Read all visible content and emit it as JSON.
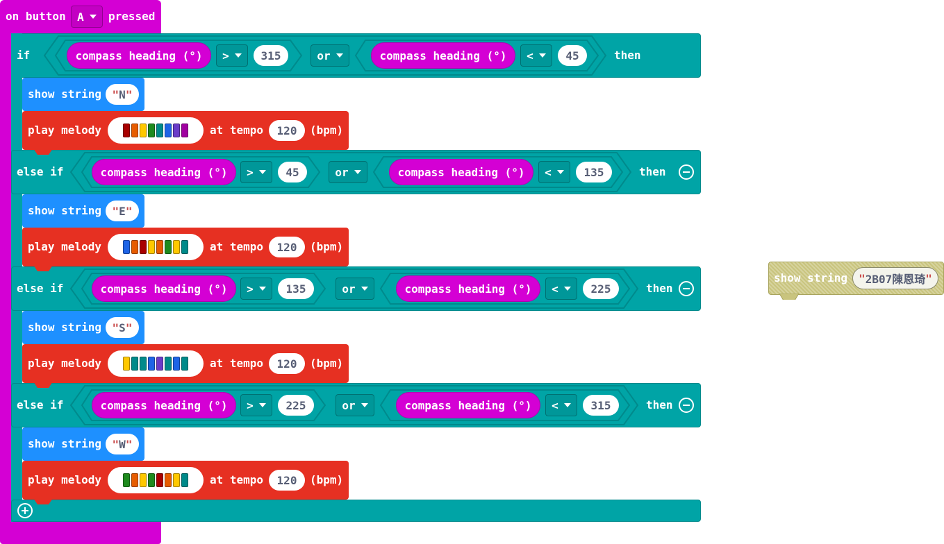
{
  "hat": {
    "prefix": "on button",
    "button": "A",
    "suffix": "pressed"
  },
  "labels": {
    "if": "if",
    "else_if": "else if",
    "then": "then",
    "or": "or",
    "show_string": "show string",
    "play_melody": "play melody",
    "at_tempo": "at tempo",
    "bpm": "(bpm)",
    "compass": "compass heading (°)"
  },
  "branches": [
    {
      "op1": ">",
      "v1": "315",
      "op2": "<",
      "v2": "45",
      "letter": "N",
      "tempo": "120",
      "notes": [
        "#a80000",
        "#e65c00",
        "#ffc800",
        "#1e8a1e",
        "#008a8a",
        "#1e64e6",
        "#6a3cc8",
        "#a000a0"
      ]
    },
    {
      "op1": ">",
      "v1": "45",
      "op2": "<",
      "v2": "135",
      "letter": "E",
      "tempo": "120",
      "notes": [
        "#1e64e6",
        "#e65c00",
        "#a80000",
        "#ffc800",
        "#e65c00",
        "#1e8a1e",
        "#ffc800",
        "#008a8a"
      ]
    },
    {
      "op1": ">",
      "v1": "135",
      "op2": "<",
      "v2": "225",
      "letter": "S",
      "tempo": "120",
      "notes": [
        "#ffc800",
        "#008a8a",
        "#008a8a",
        "#1e64e6",
        "#6a3cc8",
        "#008a8a",
        "#1e64e6",
        "#008a8a"
      ]
    },
    {
      "op1": ">",
      "v1": "225",
      "op2": "<",
      "v2": "315",
      "letter": "W",
      "tempo": "120",
      "notes": [
        "#1e8a1e",
        "#e65c00",
        "#ffc800",
        "#1e8a1e",
        "#a80000",
        "#e65c00",
        "#ffc800",
        "#008a8a"
      ]
    }
  ],
  "ghost": {
    "label": "show string",
    "value": "2B07陳恩琦"
  },
  "colors": {
    "hat": "#d400d4",
    "logic": "#00a4a6",
    "basic": "#1e90ff",
    "music": "#e63022"
  }
}
